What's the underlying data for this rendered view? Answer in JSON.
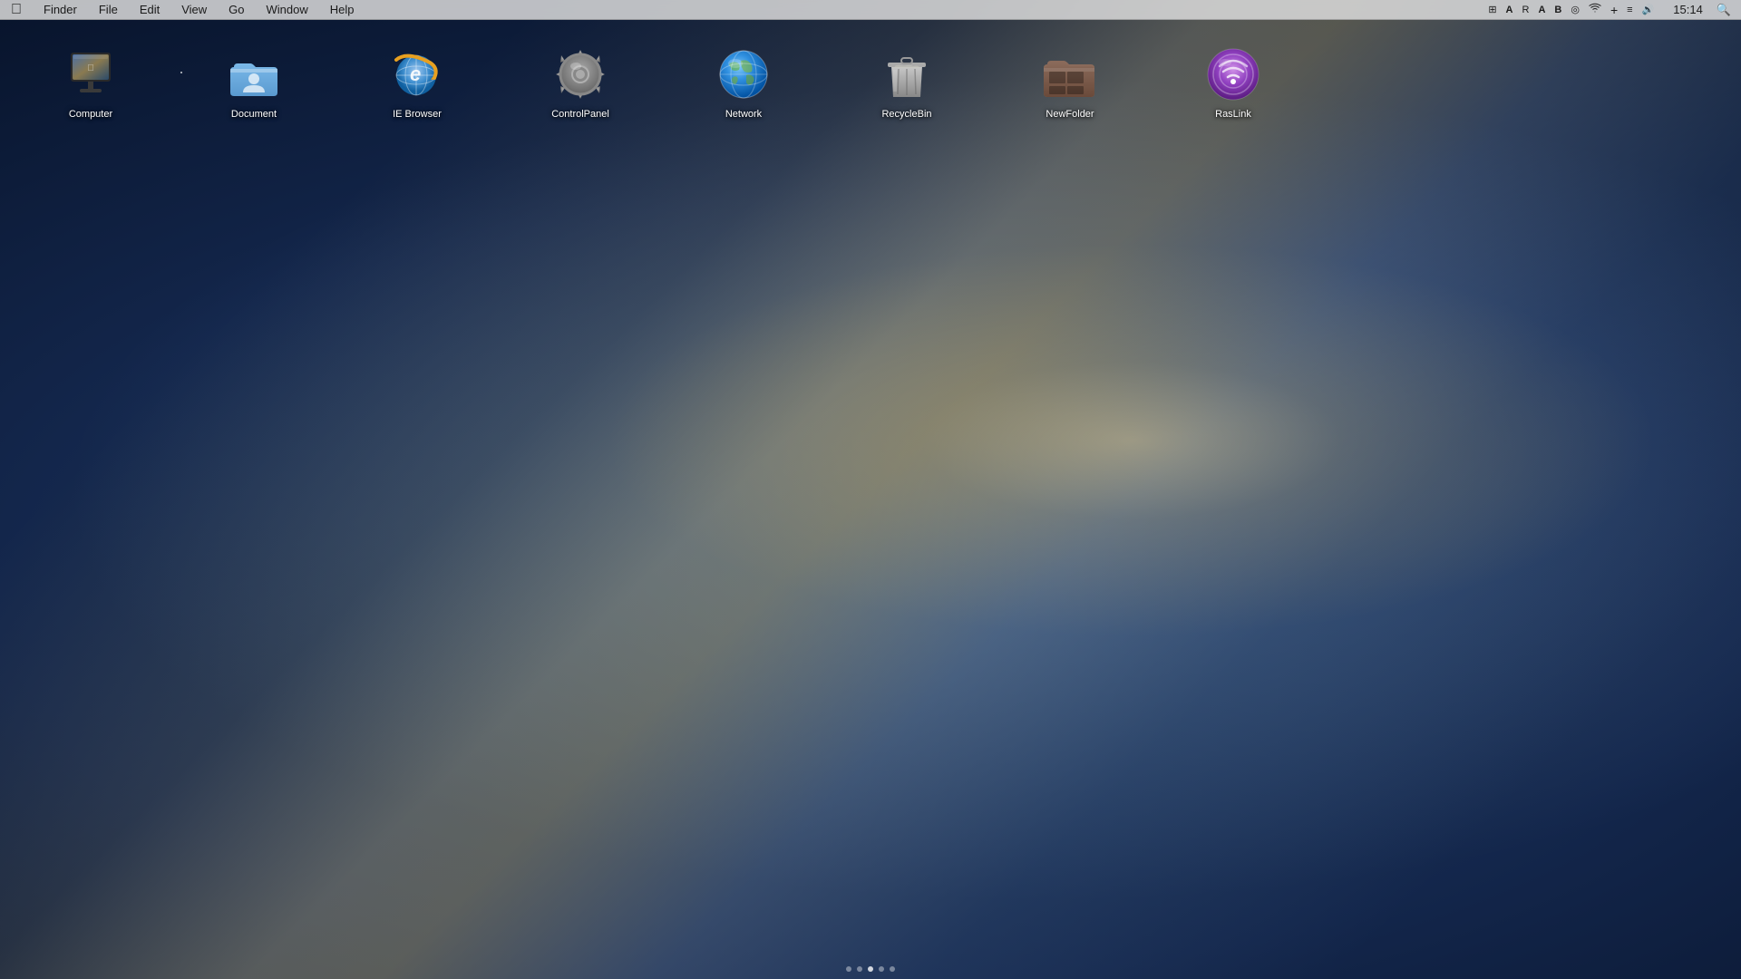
{
  "menubar": {
    "apple_label": "",
    "items": [
      "Finder",
      "File",
      "Edit",
      "View",
      "Go",
      "Window",
      "Help"
    ],
    "clock": "15:14",
    "tray_icons": [
      "⊞",
      "A",
      "R",
      "A",
      "B",
      "◉",
      "♪",
      "+",
      "📋",
      "🔊",
      "🔍"
    ]
  },
  "desktop": {
    "icons": [
      {
        "id": "computer",
        "label": "Computer",
        "type": "computer"
      },
      {
        "id": "document",
        "label": "Document",
        "type": "folder"
      },
      {
        "id": "ie-browser",
        "label": "IE Browser",
        "type": "ie"
      },
      {
        "id": "control-panel",
        "label": "ControlPanel",
        "type": "gear"
      },
      {
        "id": "network",
        "label": "Network",
        "type": "network"
      },
      {
        "id": "recycle-bin",
        "label": "RecycleBin",
        "type": "recycle"
      },
      {
        "id": "new-folder",
        "label": "NewFolder",
        "type": "newfolder"
      },
      {
        "id": "raslink",
        "label": "RasLink",
        "type": "raslink"
      }
    ]
  },
  "dock": {
    "dots": [
      false,
      false,
      true,
      false,
      false
    ]
  }
}
